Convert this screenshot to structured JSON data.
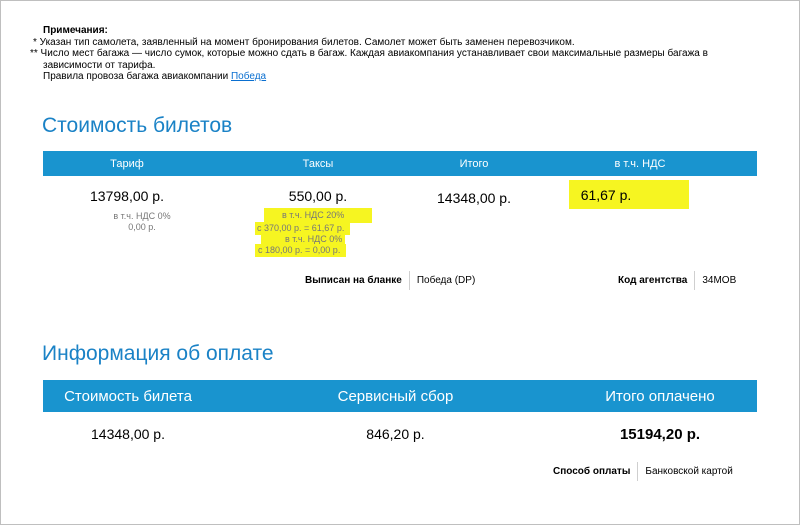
{
  "notes": {
    "title": "Примечания:",
    "line1": "* Указан тип самолета, заявленный на момент бронирования билетов. Самолет может быть заменен перевозчиком.",
    "line2a": "** Число мест багажа — число сумок, которые можно сдать в багаж. Каждая авиакомпания устанавливает свои максимальные размеры багажа в",
    "line2b": "зависимости от тарифа.",
    "line3_text": "Правила провоза багажа авиакомпании",
    "line3_link": "Победа"
  },
  "tickets": {
    "title": "Стоимость билетов",
    "headers": [
      "Тариф",
      "Таксы",
      "Итого",
      "в т.ч. НДС"
    ],
    "fare": {
      "value": "13798,00 р.",
      "vat_label": "в т.ч. НДС 0%",
      "vat_value": "0,00 р."
    },
    "taxes": {
      "value": "550,00 р.",
      "vat1_label": "в т.ч. НДС 20%",
      "vat1_value": "с 370,00 р. = 61,67 р.",
      "vat2_label": "в т.ч. НДС 0%",
      "vat2_value": "с 180,00 р. = 0,00 р."
    },
    "total": "14348,00 р.",
    "vat_total": "61,67 р.",
    "issued_on_label": "Выписан на бланке",
    "issued_on_value": "Победа (DP)",
    "agency_label": "Код агентства",
    "agency_value": "34МОВ"
  },
  "payment": {
    "title": "Информация об оплате",
    "headers": [
      "Стоимость билета",
      "Сервисный сбор",
      "Итого оплачено"
    ],
    "ticket_cost": "14348,00 р.",
    "service_fee": "846,20 р.",
    "total_paid": "15194,20 р.",
    "method_label": "Способ оплаты",
    "method_value": "Банковской картой"
  },
  "colors": {
    "accent": "#1994cf",
    "title": "#1a82c6",
    "highlight": "#f6f521"
  }
}
